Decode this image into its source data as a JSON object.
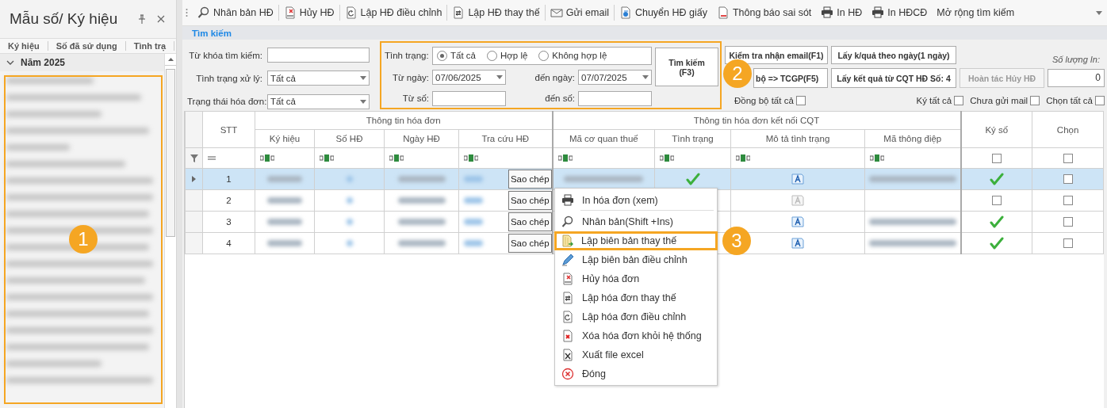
{
  "left_panel": {
    "title": "Mẫu số/ Ký hiệu",
    "columns": [
      "Ký hiệu",
      "Số đã sử dụng",
      "Tình trạ"
    ],
    "group": {
      "label": "Năm 2025",
      "expanded": true
    },
    "callout": "1"
  },
  "toolbar": [
    {
      "kind": "duplicate",
      "label": "Nhân bản HĐ"
    },
    {
      "kind": "cancel",
      "label": "Hủy HĐ"
    },
    {
      "kind": "adjust",
      "label": "Lập HĐ điều chỉnh"
    },
    {
      "kind": "replace",
      "label": "Lập HĐ thay thế"
    },
    {
      "kind": "email",
      "label": "Gửi email"
    },
    {
      "kind": "convert",
      "label": "Chuyển HĐ giấy"
    },
    {
      "kind": "report",
      "label": "Thông báo sai sót"
    },
    {
      "kind": "print",
      "label": "In HĐ"
    },
    {
      "kind": "print",
      "label": "In HĐCĐ"
    },
    {
      "kind": "plain",
      "label": "Mở rộng tìm kiếm"
    }
  ],
  "search": {
    "title": "Tìm kiếm",
    "fields": [
      {
        "label": "Từ khóa tìm kiếm:",
        "kind": "text"
      },
      {
        "label": "Tình trạng xử lý:",
        "kind": "combo",
        "value": "Tất cả"
      },
      {
        "label": "Trạng thái hóa đơn:",
        "kind": "combo",
        "value": "Tất cả"
      }
    ],
    "filter_box": {
      "callout": "2",
      "status_label": "Tình trạng:",
      "status_options": [
        {
          "label": "Tất cả",
          "selected": true
        },
        {
          "label": "Hợp lệ",
          "selected": false
        },
        {
          "label": "Không hợp lệ",
          "selected": false
        }
      ],
      "from_date": {
        "label": "Từ ngày:",
        "value": "07/06/2025"
      },
      "to_date": {
        "label": "đến ngày:",
        "value": "07/07/2025"
      },
      "from_number": {
        "label": "Từ số:"
      },
      "to_number": {
        "label": "đến số:"
      },
      "search_button": "Tìm kiếm (F3)"
    },
    "actions": [
      {
        "label": "Kiểm tra nhận email(F1)",
        "disabled": false
      },
      {
        "label": "Lấy k/quả theo ngày(1 ngày)",
        "disabled": false
      },
      {
        "label": "bộ => TCGP(F5)",
        "disabled": false
      },
      {
        "label": "Lấy kết quả từ CQT HĐ Số: 4",
        "disabled": false
      },
      {
        "label": "Hoàn tác Hủy HĐ",
        "disabled": true
      }
    ],
    "print_count": {
      "label": "Số lượng In:",
      "value": "0"
    },
    "toggles": [
      {
        "label": "Đồng bộ tất cả",
        "checked": false
      },
      {
        "label": "Ký tất cả",
        "checked": false
      },
      {
        "label": "Chưa gửi mail",
        "checked": false
      },
      {
        "label": "Chọn tất cả",
        "checked": false
      }
    ]
  },
  "grid": {
    "groups": [
      "Thông tin hóa đơn",
      "Thông tin hóa đơn kết nối CQT"
    ],
    "stt_header": "STT",
    "invoice_columns": [
      "Ký hiệu",
      "Số HĐ",
      "Ngày HĐ",
      "Tra cứu HĐ"
    ],
    "tax_columns": [
      "Mã cơ quan thuế",
      "Tình trạng",
      "Mô tả tình trạng",
      "Mã thông điệp"
    ],
    "sign_header": "Ký số",
    "choose_header": "Chọn",
    "filter": {
      "sign_checked": false,
      "choose_checked": false
    },
    "rows": [
      {
        "stt": "1",
        "selected": true,
        "copy": "Sao chép",
        "accepted": true,
        "described": true,
        "message": true,
        "signed": true,
        "chosen": false
      },
      {
        "stt": "2",
        "selected": false,
        "copy": "Sao chép",
        "described": false,
        "message": false,
        "signed": false,
        "chosen": false
      },
      {
        "stt": "3",
        "selected": false,
        "copy": "Sao chép",
        "described": true,
        "message": true,
        "signed": true,
        "chosen": false
      },
      {
        "stt": "4",
        "selected": false,
        "copy": "Sao chép",
        "described": true,
        "message": true,
        "signed": true,
        "chosen": false
      }
    ]
  },
  "context_menu": {
    "callout": "3",
    "items": [
      {
        "kind": "print",
        "label": "In hóa đơn (xem)",
        "highlighted": false,
        "separator": true
      },
      {
        "kind": "duplicate",
        "label": "Nhân bản(Shift +Ins)",
        "highlighted": false,
        "separator": false
      },
      {
        "kind": "replace_record",
        "label": "Lập biên bản thay thế",
        "highlighted": true,
        "separator": false
      },
      {
        "kind": "adjust_record",
        "label": "Lập biên bản điều chỉnh",
        "highlighted": false,
        "separator": false
      },
      {
        "kind": "cancel",
        "label": "Hủy hóa đơn",
        "highlighted": false,
        "separator": false
      },
      {
        "kind": "replace",
        "label": "Lập hóa đơn thay thế",
        "highlighted": false,
        "separator": false
      },
      {
        "kind": "adjust",
        "label": "Lập hóa đơn điều chỉnh",
        "highlighted": false,
        "separator": false
      },
      {
        "kind": "delete",
        "label": "Xóa hóa đơn khỏi hệ thống",
        "highlighted": false,
        "separator": false
      },
      {
        "kind": "excel",
        "label": "Xuất file excel",
        "highlighted": false,
        "separator": false
      },
      {
        "kind": "close",
        "label": "Đóng",
        "highlighted": false,
        "separator": false
      }
    ]
  }
}
